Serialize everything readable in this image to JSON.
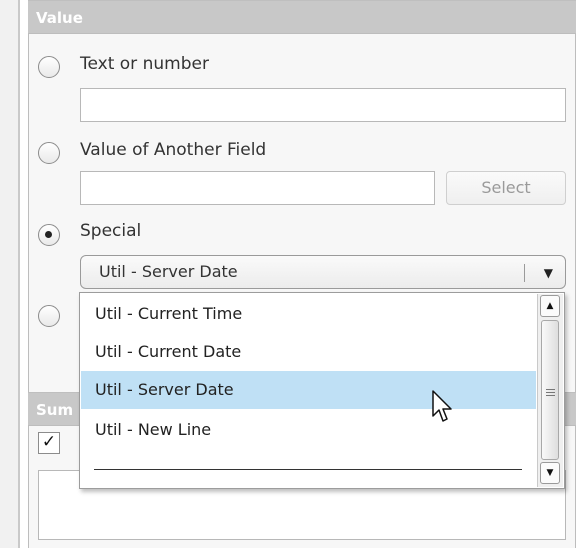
{
  "value_section": {
    "header": "Value",
    "options": [
      {
        "label": "Text or number",
        "selected": false
      },
      {
        "label": "Value of Another Field",
        "selected": false
      },
      {
        "label": "Special",
        "selected": true
      }
    ],
    "text_input": {
      "value": "",
      "placeholder": ""
    },
    "field_input": {
      "value": "",
      "placeholder": ""
    },
    "select_button": "Select",
    "special_combo": {
      "value": "Util - Server Date"
    }
  },
  "summary_section": {
    "header": "Sum",
    "checkbox_checked": true,
    "checkbox_mark": "✓",
    "text": ""
  },
  "dropdown": {
    "items": [
      "Util - Current Time",
      "Util - Current Date",
      "Util - Server Date",
      "Util - New Line"
    ],
    "selected_index": 2
  },
  "colors": {
    "header_bg": "#c8c8c8",
    "selected_item_bg": "#bfe0f5",
    "disabled_text": "#9a9a9a"
  },
  "icons": {
    "combo_arrow": "triangle-down",
    "scroll_up": "triangle-up",
    "scroll_down": "triangle-down",
    "cursor": "arrow-pointer"
  }
}
